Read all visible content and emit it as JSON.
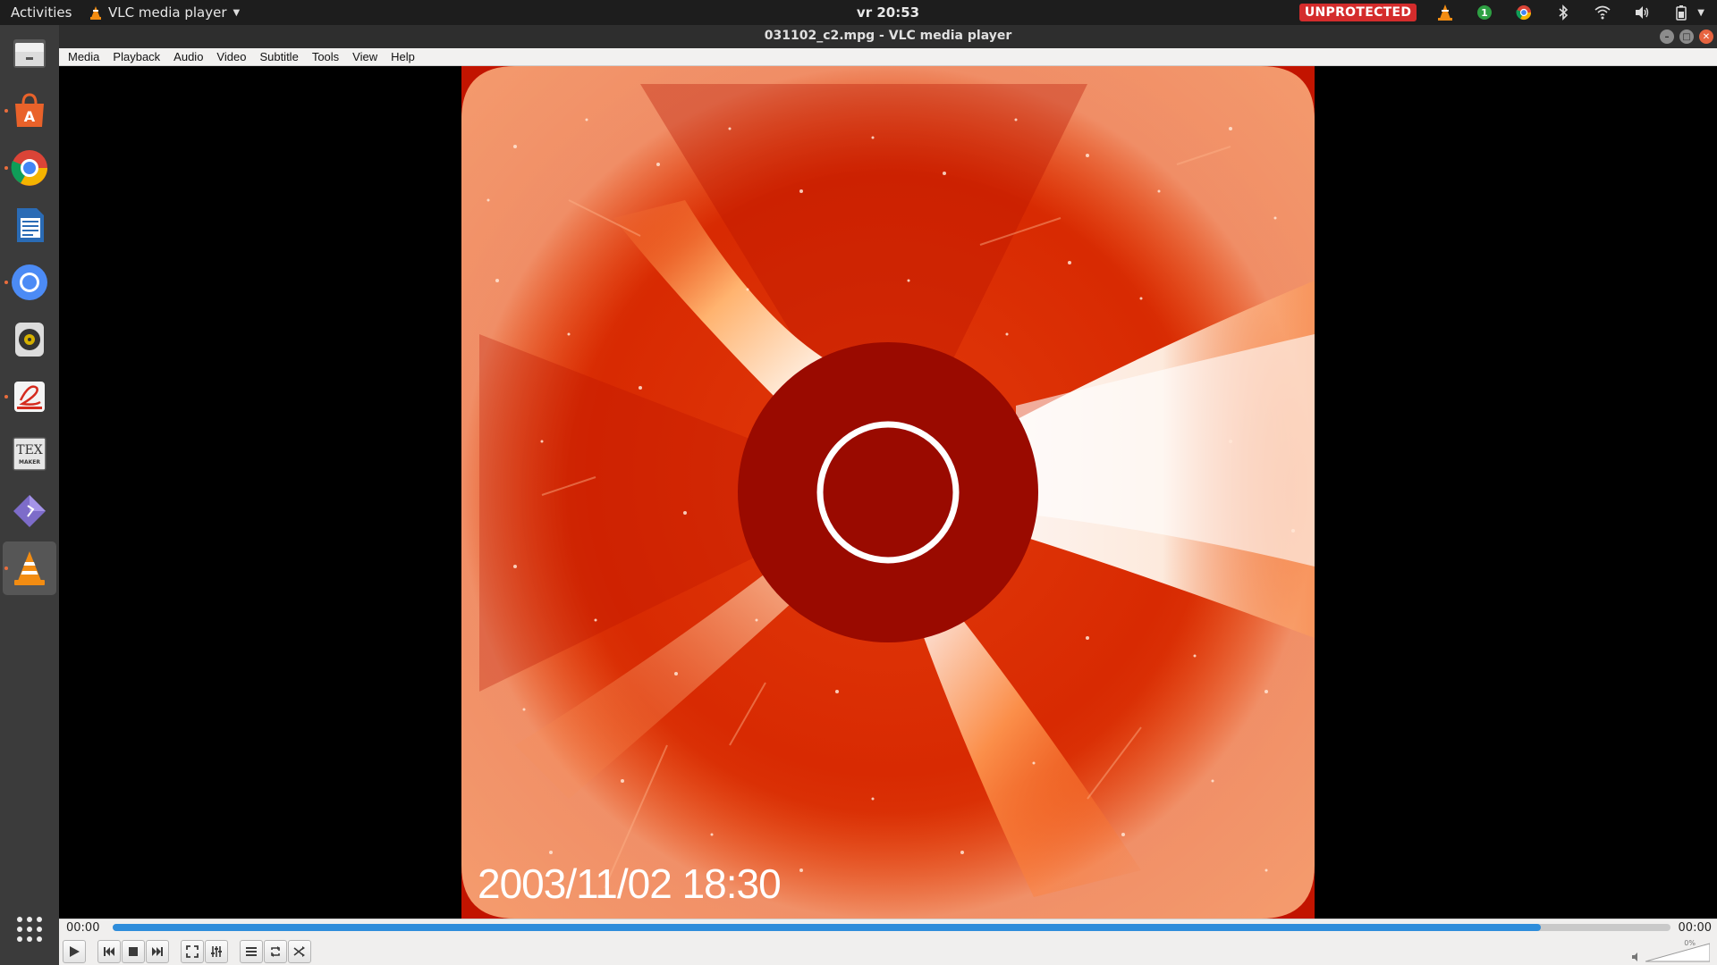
{
  "topbar": {
    "activities": "Activities",
    "app_name": "VLC media player",
    "clock": "vr 20:53",
    "vpn_status": "UNPROTECTED",
    "notification_count": "1"
  },
  "dock": {
    "items": [
      "files-icon",
      "software-center-icon",
      "chrome-icon",
      "writer-icon",
      "chromium-icon",
      "rhythmbox-icon",
      "pdf-viewer-icon",
      "texmaker-icon",
      "diamond-app-icon",
      "vlc-icon"
    ],
    "show_apps": "show-applications-icon"
  },
  "window": {
    "title": "031102_c2.mpg - VLC media player"
  },
  "menu": {
    "items": [
      "Media",
      "Playback",
      "Audio",
      "Video",
      "Subtitle",
      "Tools",
      "View",
      "Help"
    ]
  },
  "video": {
    "timestamp": "2003/11/02 18:30"
  },
  "controls": {
    "elapsed": "00:00",
    "total": "00:00",
    "progress": 0.917,
    "volume": "0%"
  },
  "colors": {
    "accent_blue": "#2e8ddb",
    "frame_red": "#c81800",
    "occulter": "#9a0a00",
    "unprotected_badge": "#d42c2c"
  }
}
